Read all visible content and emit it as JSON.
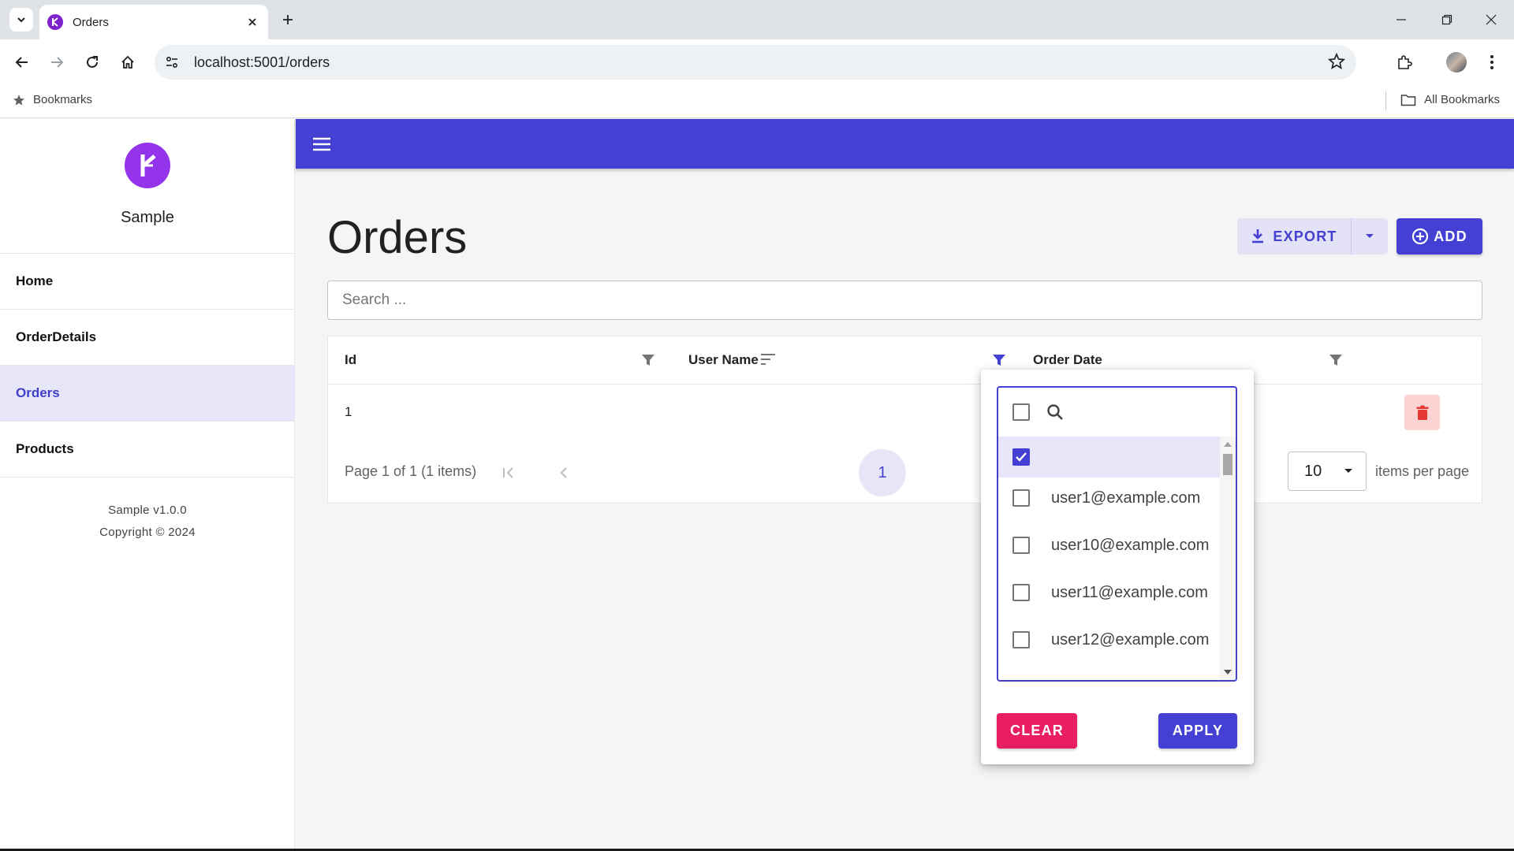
{
  "browser": {
    "tab_title": "Orders",
    "url": "localhost:5001/orders",
    "bookmarks_label": "Bookmarks",
    "all_bookmarks_label": "All Bookmarks"
  },
  "sidebar": {
    "app_name": "Sample",
    "items": [
      {
        "label": "Home",
        "active": false
      },
      {
        "label": "OrderDetails",
        "active": false
      },
      {
        "label": "Orders",
        "active": true
      },
      {
        "label": "Products",
        "active": false
      }
    ],
    "version": "Sample v1.0.0",
    "copyright": "Copyright © 2024"
  },
  "page": {
    "title": "Orders",
    "export_label": "EXPORT",
    "add_label": "ADD",
    "search_placeholder": "Search ..."
  },
  "grid": {
    "columns": [
      {
        "label": "Id",
        "filter_active": false
      },
      {
        "label": "User Name",
        "filter_active": true,
        "sortable": true
      },
      {
        "label": "Order Date",
        "filter_active": false
      }
    ],
    "rows": [
      {
        "id": "1",
        "user_name": "",
        "order_date": ""
      }
    ],
    "pager": {
      "info": "Page 1 of 1 (1 items)",
      "current_page": "1",
      "page_size": "10",
      "items_per_page_label": "items per page"
    }
  },
  "filter_popup": {
    "search_value": "",
    "options": [
      {
        "label": "",
        "checked": true
      },
      {
        "label": "user1@example.com",
        "checked": false
      },
      {
        "label": "user10@example.com",
        "checked": false
      },
      {
        "label": "user11@example.com",
        "checked": false
      },
      {
        "label": "user12@example.com",
        "checked": false
      }
    ],
    "clear_label": "CLEAR",
    "apply_label": "APPLY"
  },
  "colors": {
    "primary": "#4340d3",
    "accent_pink": "#e91e63",
    "logo_purple": "#9333ea",
    "active_bg": "#e7e6f8"
  }
}
